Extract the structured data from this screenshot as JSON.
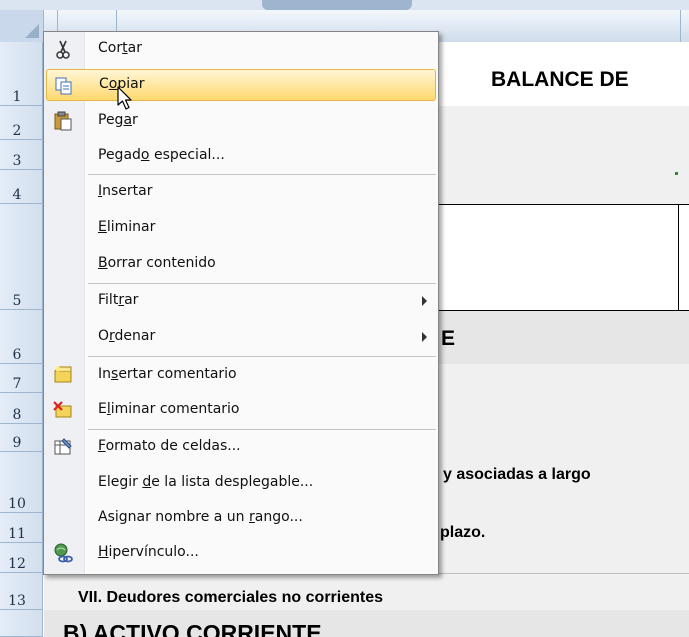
{
  "sheet": {
    "row_numbers": [
      "1",
      "2",
      "3",
      "4",
      "5",
      "6",
      "7",
      "8",
      "9",
      "10",
      "11",
      "12",
      "13"
    ],
    "cells": {
      "title": "BALANCE DE",
      "row6_text": "E",
      "row10_text": "y asociadas a largo",
      "row11_text": "plazo.",
      "row13_text": "VII.  Deudores comerciales no corrientes",
      "bottom_text": "B) ACTIVO CORRIENTE"
    }
  },
  "context_menu": {
    "items": [
      {
        "id": "cortar",
        "pre": "Cor",
        "key": "t",
        "post": "ar",
        "icon": "scissors-icon"
      },
      {
        "id": "copiar",
        "pre": "C",
        "key": "o",
        "post": "piar",
        "icon": "copy-icon",
        "highlighted": true
      },
      {
        "id": "pegar",
        "pre": "Peg",
        "key": "a",
        "post": "r",
        "icon": "paste-icon"
      },
      {
        "id": "pegado-especial",
        "pre": "Pegad",
        "key": "o",
        "post": " especial..."
      },
      {
        "id": "insertar",
        "pre": "",
        "key": "I",
        "post": "nsertar"
      },
      {
        "id": "eliminar",
        "pre": "",
        "key": "E",
        "post": "liminar"
      },
      {
        "id": "borrar-contenido",
        "pre": "",
        "key": "B",
        "post": "orrar contenido"
      },
      {
        "id": "filtrar",
        "pre": "Filt",
        "key": "r",
        "post": "ar",
        "submenu": true
      },
      {
        "id": "ordenar",
        "pre": "O",
        "key": "r",
        "post": "denar",
        "submenu": true
      },
      {
        "id": "insertar-comentario",
        "pre": "In",
        "key": "s",
        "post": "ertar comentario",
        "icon": "new-comment-icon"
      },
      {
        "id": "eliminar-comentario",
        "pre": "E",
        "key": "l",
        "post": "iminar comentario",
        "icon": "delete-comment-icon"
      },
      {
        "id": "formato-celdas",
        "pre": "",
        "key": "F",
        "post": "ormato de celdas...",
        "icon": "format-cells-icon"
      },
      {
        "id": "elegir-lista",
        "pre": "Elegir ",
        "key": "d",
        "post": "e la lista desplegable..."
      },
      {
        "id": "asignar-nombre",
        "pre": "Asignar nombre a un ",
        "key": "r",
        "post": "ango..."
      },
      {
        "id": "hipervinculo",
        "pre": "",
        "key": "H",
        "post": "ipervínculo...",
        "icon": "hyperlink-icon"
      }
    ]
  },
  "colors": {
    "highlight_top": "#fff6d6",
    "highlight_bottom": "#ffd96e",
    "header_blue": "#dbe5f1",
    "gutter": "#eef0f3"
  }
}
